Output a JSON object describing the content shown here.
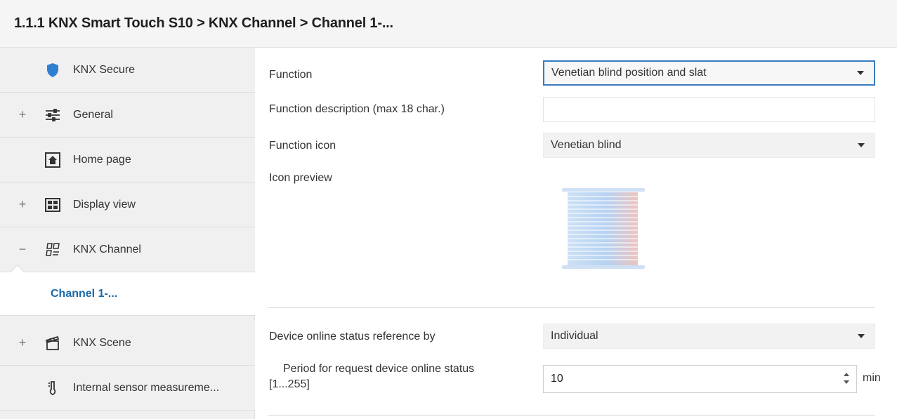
{
  "header": {
    "breadcrumb": "1.1.1 KNX Smart Touch S10 > KNX Channel  > Channel 1-..."
  },
  "sidebar": {
    "items": [
      {
        "label": "KNX Secure",
        "icon": "shield-icon",
        "expander": ""
      },
      {
        "label": "General",
        "icon": "sliders-icon",
        "expander": "+"
      },
      {
        "label": "Home page",
        "icon": "home-icon",
        "expander": ""
      },
      {
        "label": "Display view",
        "icon": "grid-icon",
        "expander": "+"
      },
      {
        "label": "KNX Channel",
        "icon": "channel-icon",
        "expander": "−"
      },
      {
        "label": "Channel 1-...",
        "icon": "",
        "expander": ""
      },
      {
        "label": "KNX Scene",
        "icon": "scene-icon",
        "expander": "+"
      },
      {
        "label": "Internal sensor measureme...",
        "icon": "thermometer-icon",
        "expander": ""
      }
    ]
  },
  "form": {
    "function_label": "Function",
    "function_value": "Venetian blind position and slat",
    "description_label": "Function description (max 18 char.)",
    "description_value": "",
    "icon_label": "Function icon",
    "icon_value": "Venetian blind",
    "preview_label": "Icon preview",
    "online_ref_label": "Device online status reference by",
    "online_ref_value": "Individual",
    "period_label_line1": "Period for request device online status",
    "period_label_line2": "[1...255]",
    "period_value": "10",
    "period_unit": "min"
  },
  "colors": {
    "accent": "#3a7bbf",
    "active_child": "#1a6aa8",
    "shield": "#2f7fd0"
  }
}
